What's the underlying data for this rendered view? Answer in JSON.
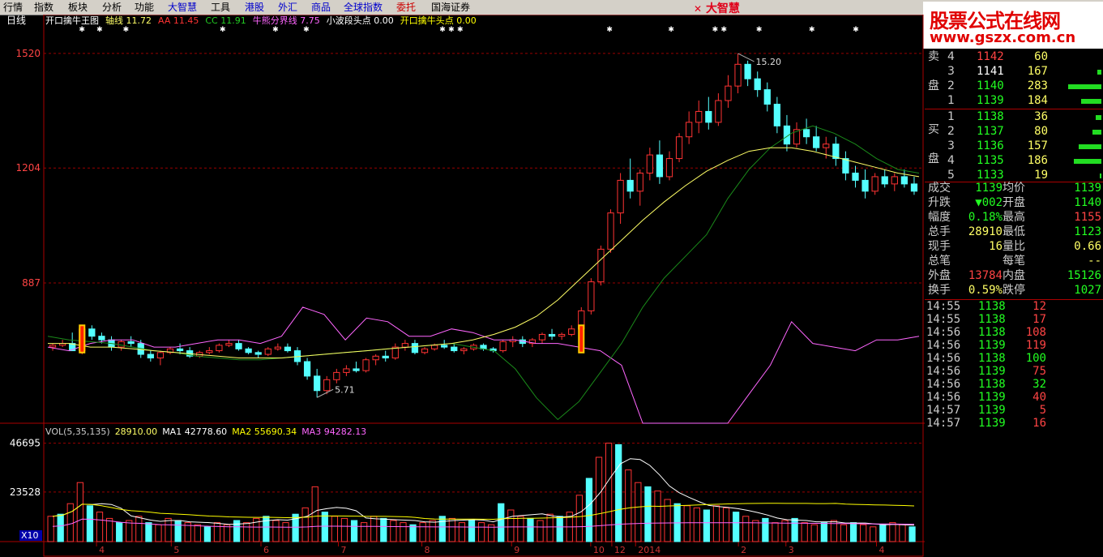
{
  "menu": [
    "行情",
    "指数",
    "板块",
    "分析",
    "功能",
    "大智慧",
    "工具",
    "港股",
    "外汇",
    "商品",
    "全球指数",
    "委托",
    "国海证券"
  ],
  "menu_colors": [
    "#000",
    "#000",
    "#000",
    "#000",
    "#000",
    "#0000cc",
    "#000",
    "#0000cc",
    "#0000cc",
    "#0000cc",
    "#0000cc",
    "#cc0000",
    "#000"
  ],
  "brand": "大智慧",
  "watermark": {
    "title": "股票公式在线网",
    "url": "www.gszx.com.cn"
  },
  "period_label": "日线",
  "indicator_header": [
    {
      "text": "开口擒牛王图",
      "color": "#ffffff"
    },
    {
      "text": "轴线 11.72",
      "color": "#ffff66"
    },
    {
      "text": "AA 11.45",
      "color": "#ff3333"
    },
    {
      "text": "CC 11.91",
      "color": "#22cc22"
    },
    {
      "text": "牛熊分界线 7.75",
      "color": "#ff66ff"
    },
    {
      "text": "小波段头点 0.00",
      "color": "#ffffff"
    },
    {
      "text": "开口擒牛头点 0.00",
      "color": "#ffff00"
    }
  ],
  "vol_header": [
    {
      "text": "VOL(5,35,135)",
      "color": "#cccccc"
    },
    {
      "text": "28910.00",
      "color": "#ffff66"
    },
    {
      "text": "MA1 42778.60",
      "color": "#ffffff"
    },
    {
      "text": "MA2 55690.34",
      "color": "#ffff00"
    },
    {
      "text": "MA3 94282.13",
      "color": "#ff66ff"
    }
  ],
  "price_axis": [
    {
      "value": 15.2,
      "label": "1520"
    },
    {
      "value": 12.04,
      "label": "1204"
    },
    {
      "value": 8.87,
      "label": "887"
    }
  ],
  "vol_axis": [
    {
      "value": 46695,
      "label": "46695"
    },
    {
      "value": 23528,
      "label": "23528"
    }
  ],
  "vol_unit": "X10",
  "x_axis": [
    {
      "label": "4",
      "pos": 0.06
    },
    {
      "label": "5",
      "pos": 0.145
    },
    {
      "label": "6",
      "pos": 0.247
    },
    {
      "label": "7",
      "pos": 0.335
    },
    {
      "label": "8",
      "pos": 0.43
    },
    {
      "label": "9",
      "pos": 0.532
    },
    {
      "label": "10",
      "pos": 0.622
    },
    {
      "label": "12",
      "pos": 0.646
    },
    {
      "label": "2014",
      "pos": 0.673
    },
    {
      "label": "2",
      "pos": 0.79
    },
    {
      "label": "3",
      "pos": 0.844
    },
    {
      "label": "4",
      "pos": 0.947
    }
  ],
  "price_annotations": [
    {
      "text": "15.20",
      "value": 15.2
    },
    {
      "text": "5.71",
      "value": 5.71
    }
  ],
  "chart_data": {
    "type": "candlestick",
    "price_range": [
      5.0,
      15.6
    ],
    "vol_range": [
      0,
      50000
    ],
    "candles": [
      [
        7.1,
        7.2,
        7.0,
        7.15
      ],
      [
        7.15,
        7.3,
        7.1,
        7.2
      ],
      [
        7.2,
        7.5,
        7.1,
        7.0
      ],
      [
        7.0,
        7.7,
        6.9,
        7.6
      ],
      [
        7.6,
        7.7,
        7.3,
        7.4
      ],
      [
        7.4,
        7.5,
        7.2,
        7.3
      ],
      [
        7.3,
        7.4,
        7.0,
        7.1
      ],
      [
        7.1,
        7.3,
        7.0,
        7.25
      ],
      [
        7.25,
        7.4,
        7.1,
        7.2
      ],
      [
        7.2,
        7.3,
        6.8,
        6.9
      ],
      [
        6.9,
        7.0,
        6.7,
        6.8
      ],
      [
        6.8,
        7.0,
        6.6,
        6.95
      ],
      [
        6.95,
        7.1,
        6.9,
        7.05
      ],
      [
        7.05,
        7.2,
        6.9,
        7.0
      ],
      [
        7.0,
        7.1,
        6.8,
        6.85
      ],
      [
        6.85,
        7.0,
        6.8,
        6.95
      ],
      [
        6.95,
        7.1,
        6.9,
        7.0
      ],
      [
        7.0,
        7.2,
        6.95,
        7.15
      ],
      [
        7.15,
        7.3,
        7.1,
        7.2
      ],
      [
        7.2,
        7.3,
        7.0,
        7.05
      ],
      [
        7.05,
        7.1,
        6.9,
        6.95
      ],
      [
        6.95,
        7.0,
        6.8,
        6.9
      ],
      [
        6.9,
        7.1,
        6.85,
        7.05
      ],
      [
        7.05,
        7.2,
        7.0,
        7.1
      ],
      [
        7.1,
        7.2,
        6.95,
        7.0
      ],
      [
        7.0,
        7.1,
        6.6,
        6.7
      ],
      [
        6.7,
        6.8,
        6.2,
        6.3
      ],
      [
        6.3,
        6.5,
        5.71,
        5.9
      ],
      [
        5.9,
        6.3,
        5.8,
        6.2
      ],
      [
        6.2,
        6.5,
        6.1,
        6.4
      ],
      [
        6.4,
        6.6,
        6.3,
        6.5
      ],
      [
        6.5,
        6.7,
        6.4,
        6.45
      ],
      [
        6.45,
        6.8,
        6.4,
        6.75
      ],
      [
        6.75,
        6.9,
        6.6,
        6.85
      ],
      [
        6.85,
        7.0,
        6.7,
        6.8
      ],
      [
        6.8,
        7.2,
        6.75,
        7.1
      ],
      [
        7.1,
        7.3,
        7.0,
        7.2
      ],
      [
        7.2,
        7.3,
        6.9,
        6.95
      ],
      [
        6.95,
        7.1,
        6.9,
        7.05
      ],
      [
        7.05,
        7.2,
        7.0,
        7.15
      ],
      [
        7.15,
        7.3,
        7.05,
        7.1
      ],
      [
        7.1,
        7.2,
        6.95,
        7.0
      ],
      [
        7.0,
        7.1,
        6.9,
        7.05
      ],
      [
        7.05,
        7.2,
        7.0,
        7.15
      ],
      [
        7.15,
        7.2,
        7.0,
        7.05
      ],
      [
        7.05,
        7.1,
        6.95,
        7.0
      ],
      [
        7.0,
        7.3,
        6.95,
        7.25
      ],
      [
        7.25,
        7.4,
        7.1,
        7.3
      ],
      [
        7.3,
        7.4,
        7.1,
        7.2
      ],
      [
        7.2,
        7.35,
        7.1,
        7.3
      ],
      [
        7.3,
        7.5,
        7.2,
        7.45
      ],
      [
        7.45,
        7.6,
        7.3,
        7.4
      ],
      [
        7.4,
        7.5,
        7.3,
        7.45
      ],
      [
        7.45,
        7.7,
        7.4,
        7.6
      ],
      [
        7.6,
        8.2,
        7.5,
        8.1
      ],
      [
        8.1,
        9.0,
        8.0,
        8.9
      ],
      [
        8.9,
        9.9,
        8.8,
        9.8
      ],
      [
        9.8,
        10.9,
        9.7,
        10.8
      ],
      [
        10.8,
        11.9,
        10.5,
        11.7
      ],
      [
        11.7,
        12.3,
        11.2,
        11.4
      ],
      [
        11.4,
        12.0,
        11.0,
        11.9
      ],
      [
        11.9,
        12.6,
        11.7,
        12.4
      ],
      [
        12.4,
        12.8,
        11.6,
        11.8
      ],
      [
        11.8,
        12.5,
        11.7,
        12.3
      ],
      [
        12.3,
        13.0,
        12.2,
        12.9
      ],
      [
        12.9,
        13.6,
        12.7,
        13.3
      ],
      [
        13.3,
        13.9,
        13.0,
        13.6
      ],
      [
        13.6,
        14.0,
        13.1,
        13.3
      ],
      [
        13.3,
        14.1,
        13.2,
        13.9
      ],
      [
        13.9,
        14.6,
        13.7,
        14.3
      ],
      [
        14.3,
        15.2,
        14.1,
        14.9
      ],
      [
        14.9,
        15.0,
        14.3,
        14.5
      ],
      [
        14.5,
        14.7,
        14.0,
        14.2
      ],
      [
        14.2,
        14.4,
        13.6,
        13.8
      ],
      [
        13.8,
        14.0,
        13.0,
        13.2
      ],
      [
        13.2,
        13.5,
        12.5,
        12.7
      ],
      [
        12.7,
        13.3,
        12.6,
        13.1
      ],
      [
        13.1,
        13.4,
        12.7,
        12.9
      ],
      [
        12.9,
        13.2,
        12.5,
        12.6
      ],
      [
        12.6,
        12.9,
        12.3,
        12.7
      ],
      [
        12.7,
        12.9,
        12.1,
        12.3
      ],
      [
        12.3,
        12.5,
        11.7,
        11.9
      ],
      [
        11.9,
        12.1,
        11.5,
        11.7
      ],
      [
        11.7,
        12.0,
        11.2,
        11.4
      ],
      [
        11.4,
        11.9,
        11.3,
        11.8
      ],
      [
        11.8,
        12.0,
        11.5,
        11.6
      ],
      [
        11.6,
        11.9,
        11.4,
        11.8
      ],
      [
        11.8,
        12.0,
        11.5,
        11.6
      ],
      [
        11.6,
        11.8,
        11.3,
        11.4
      ]
    ],
    "ma_axis": [
      7.2,
      7.2,
      7.1,
      7.1,
      7.05,
      7.0,
      6.95,
      6.9,
      6.85,
      6.8,
      6.8,
      6.8,
      6.85,
      6.9,
      6.95,
      7.0,
      7.05,
      7.1,
      7.15,
      7.2,
      7.3,
      7.45,
      7.65,
      7.95,
      8.4,
      8.95,
      9.5,
      10.05,
      10.6,
      11.1,
      11.55,
      11.95,
      12.25,
      12.5,
      12.6,
      12.6,
      12.5,
      12.35,
      12.2,
      12.05,
      11.9,
      11.8
    ],
    "ma_cc": [
      7.4,
      7.3,
      7.25,
      7.2,
      7.1,
      7.0,
      6.95,
      6.85,
      6.8,
      6.75,
      6.75,
      6.8,
      6.85,
      6.9,
      6.95,
      7.0,
      7.05,
      7.1,
      7.15,
      7.2,
      7.1,
      7.0,
      6.5,
      5.7,
      5.1,
      5.6,
      6.4,
      7.2,
      8.2,
      9.0,
      9.6,
      10.2,
      11.2,
      12.0,
      12.6,
      13.0,
      13.2,
      13.0,
      12.7,
      12.3,
      12.0,
      11.9
    ],
    "bull_bear": [
      7.1,
      7.0,
      7.2,
      7.3,
      7.3,
      7.1,
      7.1,
      7.2,
      7.3,
      7.3,
      7.2,
      7.4,
      8.2,
      8.0,
      7.3,
      7.9,
      7.8,
      7.4,
      7.4,
      7.6,
      7.5,
      7.3,
      7.3,
      7.2,
      7.2,
      7.1,
      7.0,
      6.6,
      4.8,
      3.8,
      3.5,
      4.0,
      4.8,
      5.8,
      6.6,
      7.8,
      7.2,
      7.1,
      7.0,
      7.3,
      7.3,
      7.4
    ],
    "volumes": [
      12000,
      13000,
      18000,
      28000,
      17000,
      14000,
      11000,
      9000,
      10000,
      12000,
      9000,
      8000,
      11000,
      10000,
      9000,
      8000,
      7000,
      9000,
      8000,
      10000,
      9000,
      11000,
      12000,
      10000,
      9000,
      13000,
      16000,
      26000,
      14000,
      12000,
      11000,
      10000,
      9000,
      12000,
      11000,
      10000,
      9000,
      8000,
      9000,
      10000,
      12000,
      11000,
      9000,
      10000,
      9000,
      8000,
      18000,
      15000,
      12000,
      11000,
      10000,
      13000,
      12000,
      14000,
      22000,
      30000,
      40000,
      46695,
      46000,
      34000,
      28000,
      26000,
      24000,
      20000,
      18000,
      17000,
      16000,
      15000,
      17000,
      16000,
      14000,
      12000,
      10000,
      11000,
      9000,
      10000,
      11000,
      9000,
      8000,
      9000,
      10000,
      8000,
      9000,
      8000,
      7000,
      8000,
      9000,
      8000,
      7000
    ]
  },
  "order_book": {
    "sell_label": [
      "卖",
      "盘"
    ],
    "buy_label": [
      "买",
      "盘"
    ],
    "sell": [
      {
        "level": "4",
        "price": "1142",
        "vol": "60",
        "bar": 0.0
      },
      {
        "level": "3",
        "price": "1141",
        "vol": "167",
        "bar": 0.1
      },
      {
        "level": "2",
        "price": "1140",
        "vol": "283",
        "bar": 0.9
      },
      {
        "level": "1",
        "price": "1139",
        "vol": "184",
        "bar": 0.55
      }
    ],
    "buy": [
      {
        "level": "1",
        "price": "1138",
        "vol": "36",
        "bar": 0.15
      },
      {
        "level": "2",
        "price": "1137",
        "vol": "80",
        "bar": 0.25
      },
      {
        "level": "3",
        "price": "1136",
        "vol": "157",
        "bar": 0.6
      },
      {
        "level": "4",
        "price": "1135",
        "vol": "186",
        "bar": 0.75
      },
      {
        "level": "5",
        "price": "1133",
        "vol": "19",
        "bar": 0.05
      }
    ]
  },
  "stats": [
    {
      "l1": "成交",
      "v1": "1139",
      "c1": "#22ff22",
      "l2": "均价",
      "v2": "1139",
      "c2": "#22ff22"
    },
    {
      "l1": "升跌",
      "v1": "▼002",
      "c1": "#22ff22",
      "l2": "开盘",
      "v2": "1140",
      "c2": "#22ff22"
    },
    {
      "l1": "幅度",
      "v1": "0.18%",
      "c1": "#22ff22",
      "l2": "最高",
      "v2": "1155",
      "c2": "#ff4444"
    },
    {
      "l1": "总手",
      "v1": "28910",
      "c1": "#ffff66",
      "l2": "最低",
      "v2": "1123",
      "c2": "#22ff22"
    },
    {
      "l1": "现手",
      "v1": "16",
      "c1": "#ffff66",
      "l2": "量比",
      "v2": "0.66",
      "c2": "#ffff66"
    },
    {
      "l1": "总笔",
      "v1": "",
      "c1": "#ffff66",
      "l2": "每笔",
      "v2": "--",
      "c2": "#ffff66"
    },
    {
      "l1": "外盘",
      "v1": "13784",
      "c1": "#ff4444",
      "l2": "内盘",
      "v2": "15126",
      "c2": "#22ff22"
    },
    {
      "l1": "换手",
      "v1": "0.59%",
      "c1": "#ffff66",
      "l2": "跌停",
      "v2": "1027",
      "c2": "#22ff22"
    }
  ],
  "ticks": [
    {
      "time": "14:55",
      "price": "1138",
      "vol": "12",
      "pc": "#22ff22",
      "vc": "#ff4444"
    },
    {
      "time": "14:55",
      "price": "1138",
      "vol": "17",
      "pc": "#22ff22",
      "vc": "#ff4444"
    },
    {
      "time": "14:56",
      "price": "1138",
      "vol": "108",
      "pc": "#22ff22",
      "vc": "#ff4444"
    },
    {
      "time": "14:56",
      "price": "1139",
      "vol": "119",
      "pc": "#22ff22",
      "vc": "#ff4444"
    },
    {
      "time": "14:56",
      "price": "1138",
      "vol": "100",
      "pc": "#22ff22",
      "vc": "#22ff22"
    },
    {
      "time": "14:56",
      "price": "1139",
      "vol": "75",
      "pc": "#22ff22",
      "vc": "#ff4444"
    },
    {
      "time": "14:56",
      "price": "1138",
      "vol": "32",
      "pc": "#22ff22",
      "vc": "#22ff22"
    },
    {
      "time": "14:56",
      "price": "1139",
      "vol": "40",
      "pc": "#22ff22",
      "vc": "#ff4444"
    },
    {
      "time": "14:57",
      "price": "1139",
      "vol": "5",
      "pc": "#22ff22",
      "vc": "#ff4444"
    },
    {
      "time": "14:57",
      "price": "1139",
      "vol": "16",
      "pc": "#22ff22",
      "vc": "#ff4444"
    }
  ],
  "colors": {
    "up": "#ff3333",
    "down": "#54ffff",
    "grid": "#990000",
    "axis_text": "#ff4444"
  }
}
